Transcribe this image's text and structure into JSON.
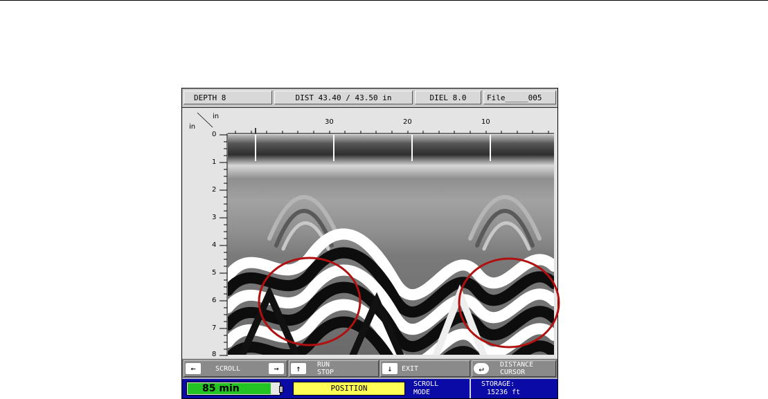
{
  "header": {
    "depth": "DEPTH  8",
    "dist": "DIST 43.40 / 43.50 in",
    "diel": "DIEL 8.0",
    "file": "File_____005"
  },
  "axes": {
    "x_unit": "in",
    "y_unit": "in",
    "x_ticks": [
      "30",
      "20",
      "10"
    ],
    "y_ticks": [
      "0",
      "1",
      "2",
      "3",
      "4",
      "5",
      "6",
      "7",
      "8"
    ]
  },
  "controls": {
    "scroll": "SCROLL",
    "run": "RUN",
    "stop": "STOP",
    "exit": "EXIT",
    "distance": "DISTANCE",
    "cursor": "CURSOR"
  },
  "status": {
    "battery": "85 min",
    "position": "POSITION",
    "mode_line1": "SCROLL",
    "mode_line2": "MODE",
    "storage_label": "STORAGE:",
    "storage_value": "15236 ft"
  },
  "colors": {
    "status_bar": "#0a0aa6",
    "battery": "#22c322",
    "position": "#ffff55",
    "highlight_circle": "#b01010"
  },
  "icons": {
    "left": "arrow-left-icon",
    "right": "arrow-right-icon",
    "up": "arrow-up-icon",
    "down": "arrow-down-icon",
    "enter": "enter-icon"
  }
}
